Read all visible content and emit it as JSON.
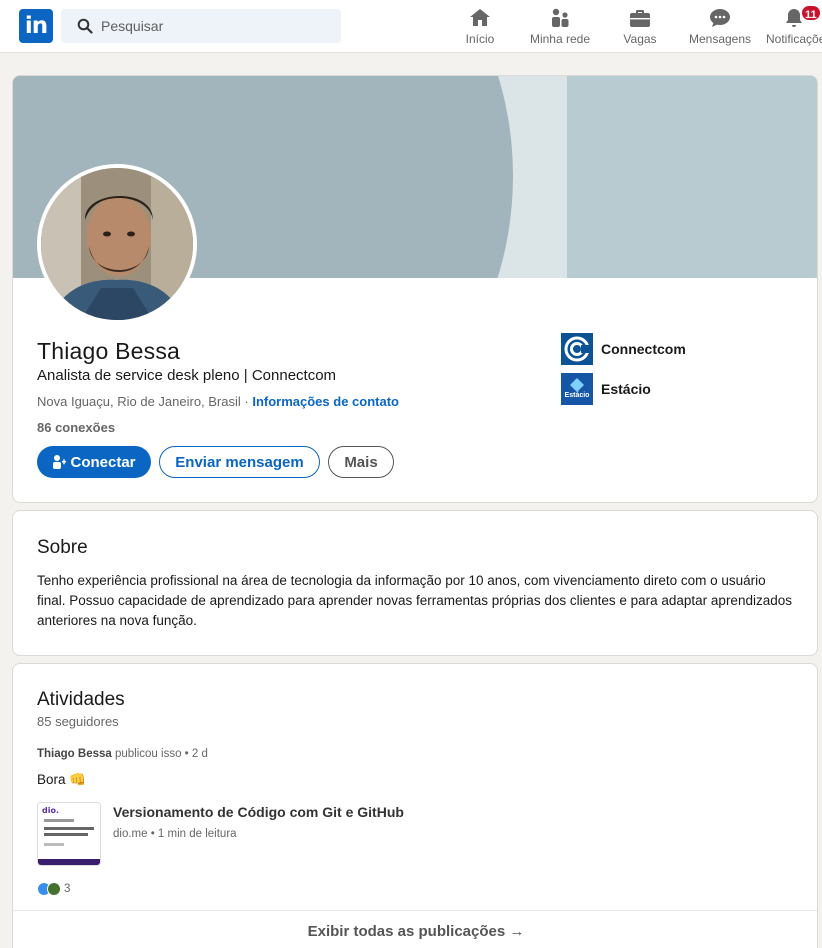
{
  "nav": {
    "logo_text": "in",
    "search_placeholder": "Pesquisar",
    "items": [
      {
        "label": "Início",
        "icon": "home-icon"
      },
      {
        "label": "Minha rede",
        "icon": "people-icon"
      },
      {
        "label": "Vagas",
        "icon": "briefcase-icon"
      },
      {
        "label": "Mensagens",
        "icon": "chat-icon"
      },
      {
        "label": "Notificações",
        "icon": "bell-icon",
        "badge": "11"
      }
    ]
  },
  "profile": {
    "name": "Thiago Bessa",
    "headline": "Analista de service desk pleno | Connectcom",
    "location": "Nova Iguaçu, Rio de Janeiro, Brasil",
    "separator": " · ",
    "contact_link": "Informações de contato",
    "connections": "86 conexões",
    "buttons": {
      "connect": "Conectar",
      "message": "Enviar mensagem",
      "more": "Mais"
    },
    "orgs": [
      {
        "name": "Connectcom",
        "icon": "connectcom-logo"
      },
      {
        "name": "Estácio",
        "icon": "estacio-logo",
        "logo_text": "Estácio"
      }
    ]
  },
  "about": {
    "title": "Sobre",
    "text": "Tenho experiência profissional na área de tecnologia da informação por 10 anos, com vivenciamento direto com o usuário final. Possuo capacidade de aprendizado para aprender novas ferramentas próprias dos clientes e para adaptar aprendizados anteriores na nova função."
  },
  "activity": {
    "title": "Atividades",
    "followers": "85 seguidores",
    "post": {
      "author": "Thiago Bessa",
      "action": " publicou isso • 2 d",
      "text": "Bora",
      "emoji": "👊",
      "article_title": "Versionamento de Código com Git e GitHub",
      "article_meta": "dio.me • 1 min de leitura",
      "thumb_brand": "dio.",
      "reactions_count": "3"
    },
    "show_all": "Exibir todas as publicações →"
  },
  "colors": {
    "brand": "#0a66c2",
    "badge": "#cb112d"
  }
}
